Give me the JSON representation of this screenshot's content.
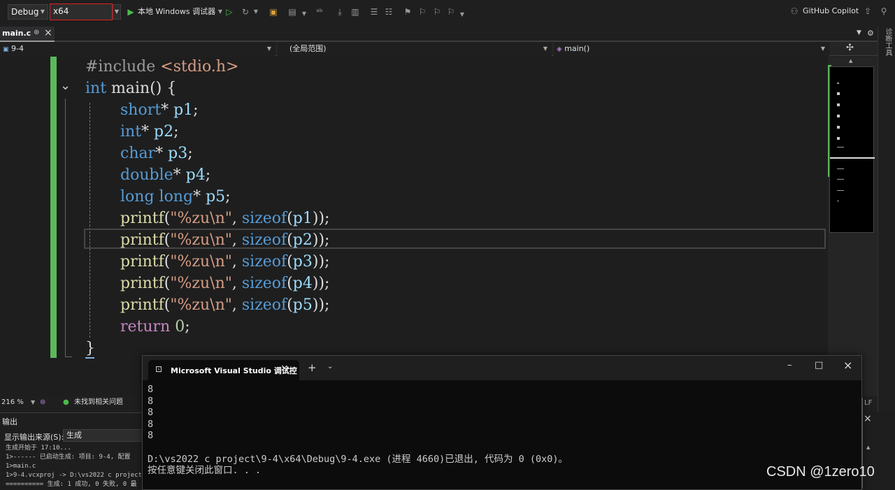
{
  "toolbar": {
    "configuration": "Debug",
    "platform": "x64",
    "run_label": "本地 Windows 调试器",
    "copilot_label": "GitHub Copilot"
  },
  "tab": {
    "filename": "main.c",
    "pin": "⊕",
    "close": "×"
  },
  "nav": {
    "project": "9-4",
    "scope": "(全局范围)",
    "member": "main()"
  },
  "side_tool": "诊断工具",
  "code": {
    "line1_include": "#include",
    "line1_header": "<stdio.h>",
    "int_kw": "int",
    "main_sig": " main() {",
    "decl1_type": "short",
    "decl1_var": "p1",
    "decl2_type": "int",
    "decl2_var": "p2",
    "decl3_type": "char",
    "decl3_var": "p3",
    "decl4_type": "double",
    "decl4_var": "p4",
    "decl5_type": "long long",
    "decl5_var": "p5",
    "printf": "printf",
    "fmt": "\"%zu\\n\"",
    "sizeof": "sizeof",
    "return_kw": "return",
    "zero": "0",
    "close_brace": "}"
  },
  "status": {
    "zoom": "216 %",
    "issues": "未找到相关问题",
    "line_end": "LF"
  },
  "output": {
    "title": "输出",
    "source_label": "显示输出来源(S):",
    "source_value": "生成",
    "lines": [
      "生成开始于 17:10...",
      "1>------ 已启动生成: 项目: 9-4, 配置",
      "1>main.c",
      "1>9-4.vcxproj -> D:\\vs2022 c project",
      "========== 生成: 1 成功, 0 失败, 0 最"
    ]
  },
  "terminal": {
    "tab_title": "Microsoft Visual Studio 调试控",
    "output_numbers": [
      "8",
      "8",
      "8",
      "8",
      "8"
    ],
    "exit_line": "D:\\vs2022 c project\\9-4\\x64\\Debug\\9-4.exe (进程 4660)已退出, 代码为 0 (0x0)。",
    "press_key_line": "按任意键关闭此窗口. . ."
  },
  "watermark": "CSDN @1zero10",
  "colors": {
    "accent_green": "#5cb85c",
    "keyword": "#569cd6",
    "function": "#dcdcaa",
    "string": "#d69d85",
    "variable": "#9cdcfe"
  }
}
